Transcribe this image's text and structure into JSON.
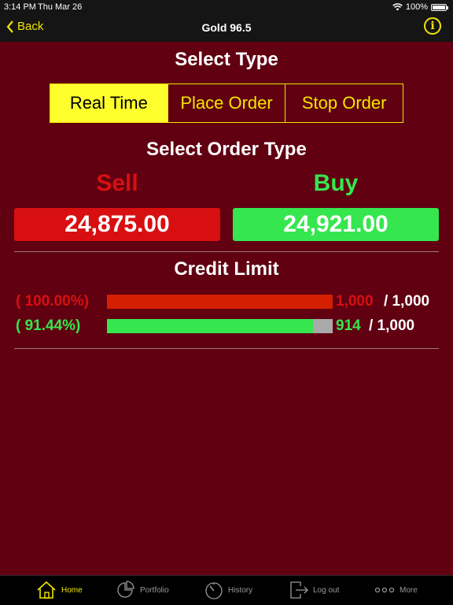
{
  "status_bar": {
    "time": "3:14 PM",
    "date": "Thu Mar 26",
    "battery": "100%"
  },
  "nav": {
    "back_label": "Back",
    "title": "Gold 96.5",
    "info_glyph": "i"
  },
  "select_type": {
    "heading": "Select Type",
    "segments": [
      "Real Time",
      "Place Order",
      "Stop Order"
    ],
    "active_index": 0
  },
  "order": {
    "heading": "Select Order Type",
    "sell_label": "Sell",
    "buy_label": "Buy",
    "sell_price": "24,875.00",
    "buy_price": "24,921.00"
  },
  "credit": {
    "heading": "Credit Limit",
    "rows": [
      {
        "percent": "( 100.00%)",
        "fraction": 1.0,
        "used": "1,000",
        "total": "/ 1,000",
        "color": "#d42000",
        "text_color": "#d80f10"
      },
      {
        "percent": "( 91.44%)",
        "fraction": 0.9144,
        "used": "914",
        "total": "/ 1,000",
        "color": "#36e64e",
        "text_color": "#36e64e"
      }
    ]
  },
  "tabs": [
    {
      "label": "Home",
      "icon": "home-icon"
    },
    {
      "label": "Portfolio",
      "icon": "pie-chart-icon"
    },
    {
      "label": "History",
      "icon": "gauge-icon"
    },
    {
      "label": "Log out",
      "icon": "logout-icon"
    },
    {
      "label": "More",
      "icon": "more-dots-icon"
    }
  ],
  "colors": {
    "background": "#600011",
    "accent": "#f2e600",
    "sell": "#d80f10",
    "buy": "#36e64e"
  }
}
